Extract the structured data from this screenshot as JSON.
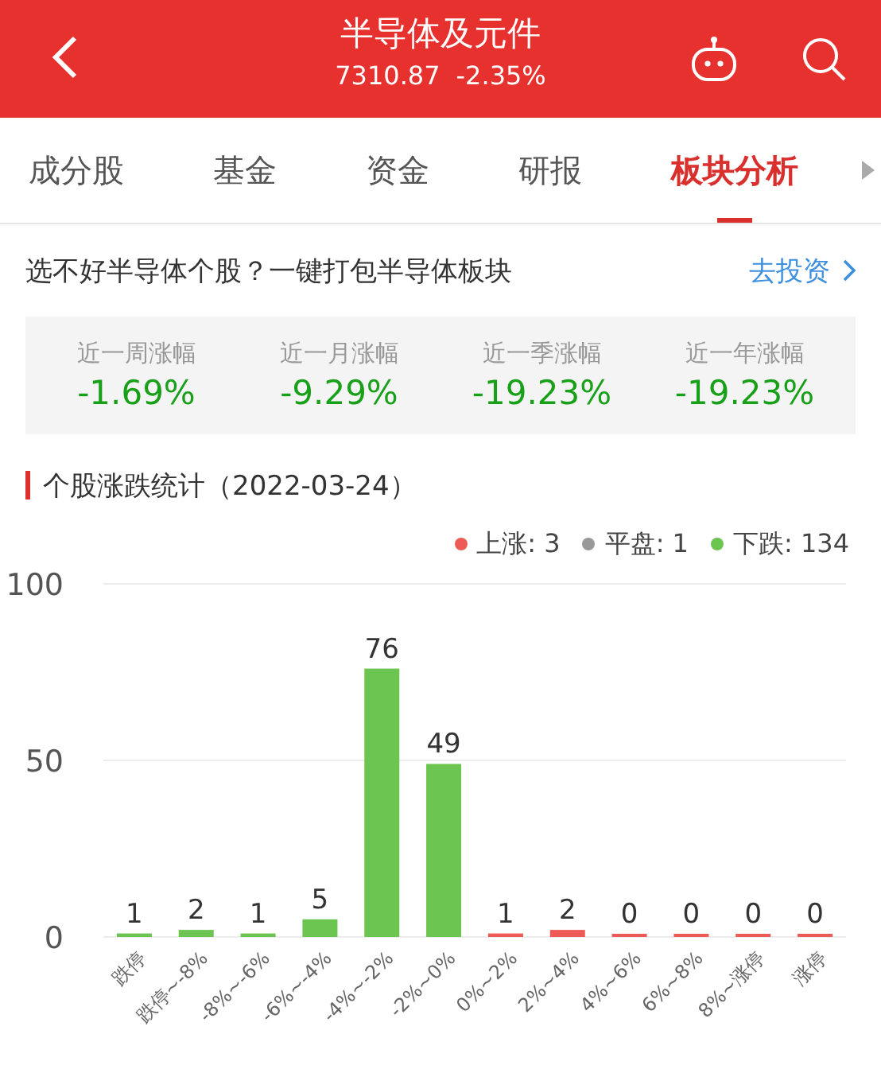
{
  "header": {
    "title": "半导体及元件",
    "price": "7310.87",
    "change": "-2.35%"
  },
  "tabs": [
    {
      "label": "成分股",
      "selected": false
    },
    {
      "label": "基金",
      "selected": false
    },
    {
      "label": "资金",
      "selected": false
    },
    {
      "label": "研报",
      "selected": false
    },
    {
      "label": "板块分析",
      "selected": true
    }
  ],
  "promo": {
    "text": "选不好半导体个股？一键打包半导体板块",
    "link": "去投资"
  },
  "period_stats": [
    {
      "label": "近一周涨幅",
      "value": "-1.69%"
    },
    {
      "label": "近一月涨幅",
      "value": "-9.29%"
    },
    {
      "label": "近一季涨幅",
      "value": "-19.23%"
    },
    {
      "label": "近一年涨幅",
      "value": "-19.23%"
    }
  ],
  "distribution": {
    "title": "个股涨跌统计（2022-03-24）",
    "legend": [
      {
        "label": "上涨: 3",
        "color": "#ec5b56"
      },
      {
        "label": "平盘: 1",
        "color": "#999999"
      },
      {
        "label": "下跌: 134",
        "color": "#6cc551"
      }
    ],
    "chart_data": {
      "type": "bar",
      "categories": [
        "跌停",
        "跌停~-8%",
        "-8%~-6%",
        "-6%~-4%",
        "-4%~-2%",
        "-2%~0%",
        "0%~2%",
        "2%~4%",
        "4%~6%",
        "6%~8%",
        "8%~涨停",
        "涨停"
      ],
      "series": [
        {
          "color": "#6cc551",
          "values": [
            1,
            2,
            1,
            5,
            76,
            49,
            null,
            null,
            null,
            null,
            null,
            null
          ]
        },
        {
          "color": "#ec5b56",
          "values": [
            null,
            null,
            null,
            null,
            null,
            null,
            1,
            2,
            0,
            0,
            0,
            0
          ]
        }
      ],
      "ylim": [
        0,
        100
      ],
      "yticks": [
        0,
        50,
        100
      ],
      "data_labels": true
    }
  }
}
